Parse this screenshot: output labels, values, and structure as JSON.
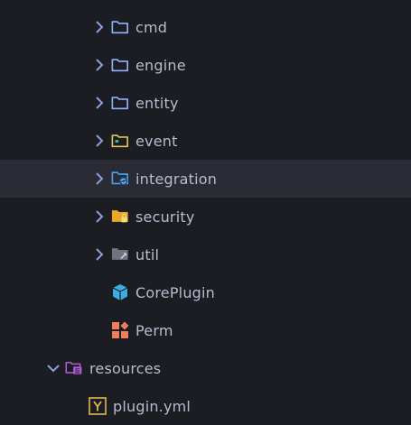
{
  "tree": {
    "items": [
      {
        "label": "cmd",
        "icon": "folder-icon",
        "expanded": false
      },
      {
        "label": "engine",
        "icon": "folder-icon",
        "expanded": false
      },
      {
        "label": "entity",
        "icon": "folder-icon",
        "expanded": false
      },
      {
        "label": "event",
        "icon": "event-folder-icon",
        "expanded": false
      },
      {
        "label": "integration",
        "icon": "integration-folder-icon",
        "expanded": false,
        "selected": true
      },
      {
        "label": "security",
        "icon": "security-folder-icon",
        "expanded": false
      },
      {
        "label": "util",
        "icon": "util-folder-icon",
        "expanded": false
      },
      {
        "label": "CorePlugin",
        "icon": "class-cube-icon"
      },
      {
        "label": "Perm",
        "icon": "shapes-icon"
      },
      {
        "label": "resources",
        "icon": "resources-folder-icon",
        "expanded": true
      },
      {
        "label": "plugin.yml",
        "icon": "yaml-file-icon"
      }
    ]
  },
  "colors": {
    "background": "#1c1c23",
    "selected_row": "#2a2b34",
    "text": "#b9bccf",
    "chevron": "#8aa1d8",
    "folder_outline": "#8fb3ff",
    "resources": "#b45bd6",
    "yaml": "#e3b84f"
  }
}
